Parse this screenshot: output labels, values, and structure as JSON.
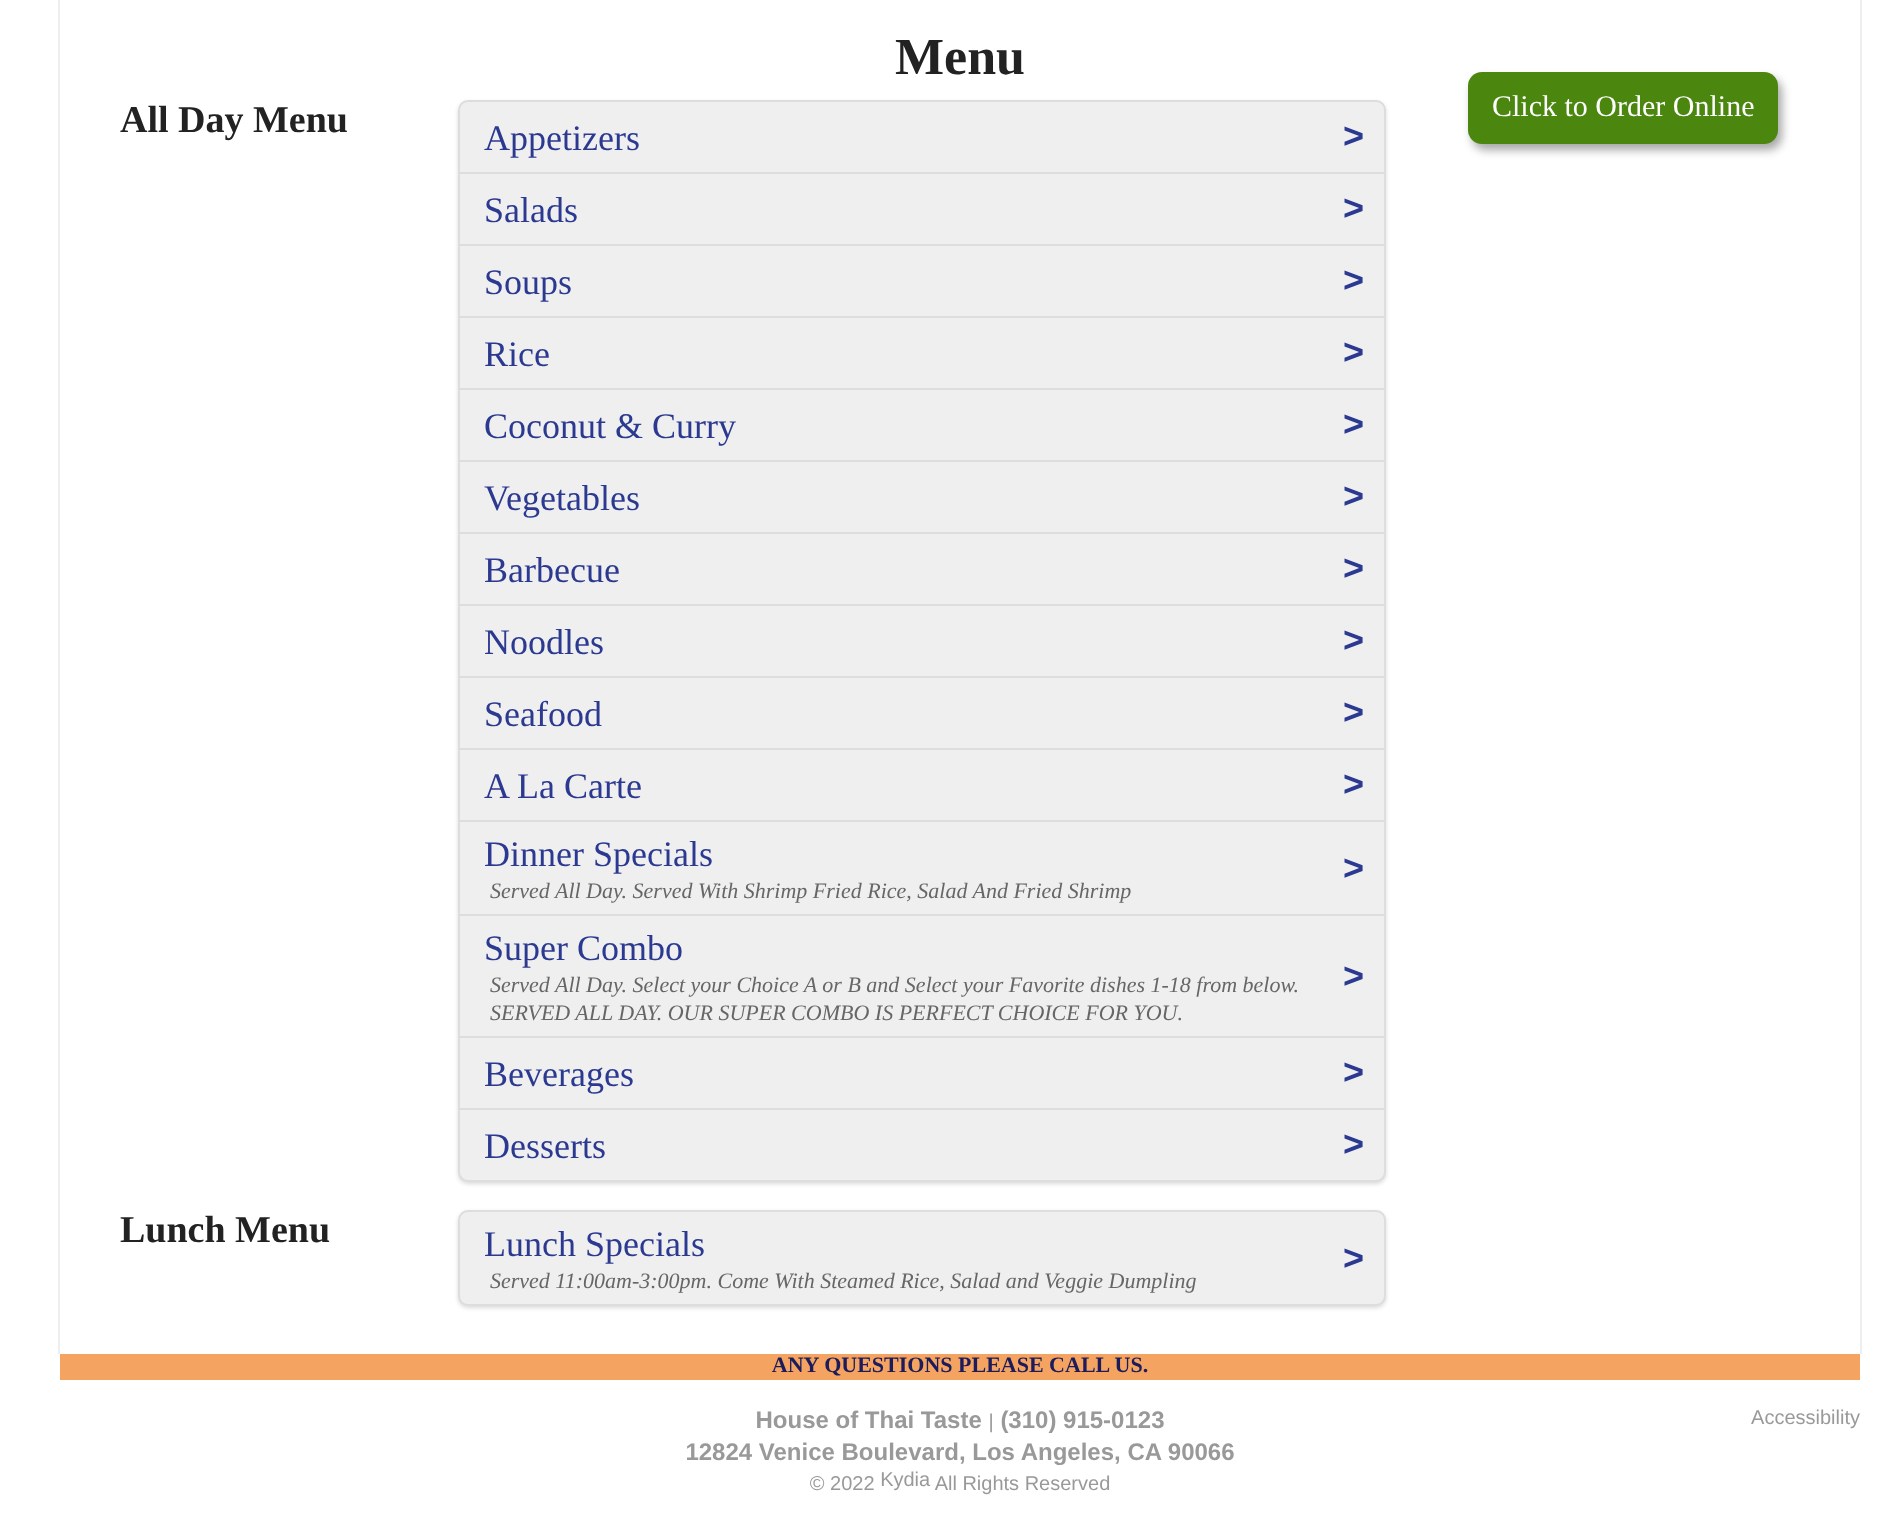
{
  "title": "Menu",
  "order_button": "Click to Order Online",
  "sections": [
    {
      "heading": "All Day Menu",
      "items": [
        {
          "name": "Appetizers",
          "arrow": ">"
        },
        {
          "name": "Salads",
          "arrow": ">"
        },
        {
          "name": "Soups",
          "arrow": ">"
        },
        {
          "name": "Rice",
          "arrow": ">"
        },
        {
          "name": "Coconut & Curry",
          "arrow": ">"
        },
        {
          "name": "Vegetables",
          "arrow": ">"
        },
        {
          "name": "Barbecue",
          "arrow": ">"
        },
        {
          "name": "Noodles",
          "arrow": ">"
        },
        {
          "name": "Seafood",
          "arrow": ">"
        },
        {
          "name": "A La Carte",
          "arrow": ">"
        },
        {
          "name": "Dinner Specials",
          "description": "Served All Day. Served With Shrimp Fried Rice, Salad And Fried Shrimp",
          "arrow": ">"
        },
        {
          "name": "Super Combo",
          "description": "Served All Day. Select your Choice A or B and Select your Favorite dishes 1-18 from below. SERVED ALL DAY. OUR SUPER COMBO IS PERFECT CHOICE FOR YOU.",
          "arrow": ">"
        },
        {
          "name": "Beverages",
          "arrow": ">"
        },
        {
          "name": "Desserts",
          "arrow": ">"
        }
      ]
    },
    {
      "heading": "Lunch Menu",
      "items": [
        {
          "name": "Lunch Specials",
          "description": "Served 11:00am-3:00pm. Come With Steamed Rice, Salad and Veggie Dumpling",
          "arrow": ">"
        }
      ]
    }
  ],
  "footer": {
    "banner": "ANY QUESTIONS PLEASE CALL US.",
    "business_name": "House of Thai Taste",
    "separator": "|",
    "phone": "(310) 915-0123",
    "address": "12824 Venice Boulevard, Los Angeles, CA 90066",
    "copyright": "© 2022",
    "credit": "Kydia",
    "rights": "All Rights Reserved",
    "accessibility": "Accessibility"
  }
}
